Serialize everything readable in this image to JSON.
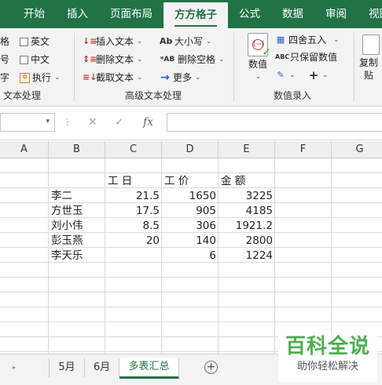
{
  "menu_tabs": [
    "开始",
    "插入",
    "页面布局",
    "方方格子",
    "公式",
    "数据",
    "审阅",
    "视图"
  ],
  "active_menu_tab": "方方格子",
  "ribbon": {
    "group1": {
      "label": "文本处理",
      "left_col": [
        "格",
        "号",
        "字"
      ],
      "items": [
        "英文",
        "中文",
        "执行"
      ]
    },
    "group2": {
      "label": "高级文本处理",
      "items_left": [
        "插入文本",
        "删除文本",
        "截取文本"
      ],
      "items_right": [
        "大小写",
        "删除空格",
        "更多"
      ]
    },
    "group3": {
      "label": "数值录入",
      "big_button": "数值",
      "items": [
        "四舍五入",
        "只保留数值"
      ]
    },
    "group4": {
      "copy_label_1": "复制",
      "copy_label_2": "贴"
    }
  },
  "formula_bar": {
    "name_box": "",
    "formula": "",
    "fx": "fx"
  },
  "columns": [
    "A",
    "B",
    "C",
    "D",
    "E",
    "F",
    "G"
  ],
  "table": {
    "headers": [
      "工 日",
      "工 价",
      "金 额"
    ],
    "rows": [
      {
        "name": "李二",
        "days": "21.5",
        "price": "1650",
        "amount": "3225"
      },
      {
        "name": "方世玉",
        "days": "17.5",
        "price": "905",
        "amount": "4185"
      },
      {
        "name": "刘小伟",
        "days": "8.5",
        "price": "306",
        "amount": "1921.2"
      },
      {
        "name": "彭玉燕",
        "days": "20",
        "price": "140",
        "amount": "2800"
      },
      {
        "name": "李天乐",
        "days": "",
        "price": "6",
        "amount": "1224"
      }
    ]
  },
  "sheet_tabs": [
    "5月",
    "6月",
    "多表汇总"
  ],
  "active_sheet": "多表汇总",
  "watermark": {
    "title": "百科全说",
    "subtitle": "助你轻松解决"
  }
}
